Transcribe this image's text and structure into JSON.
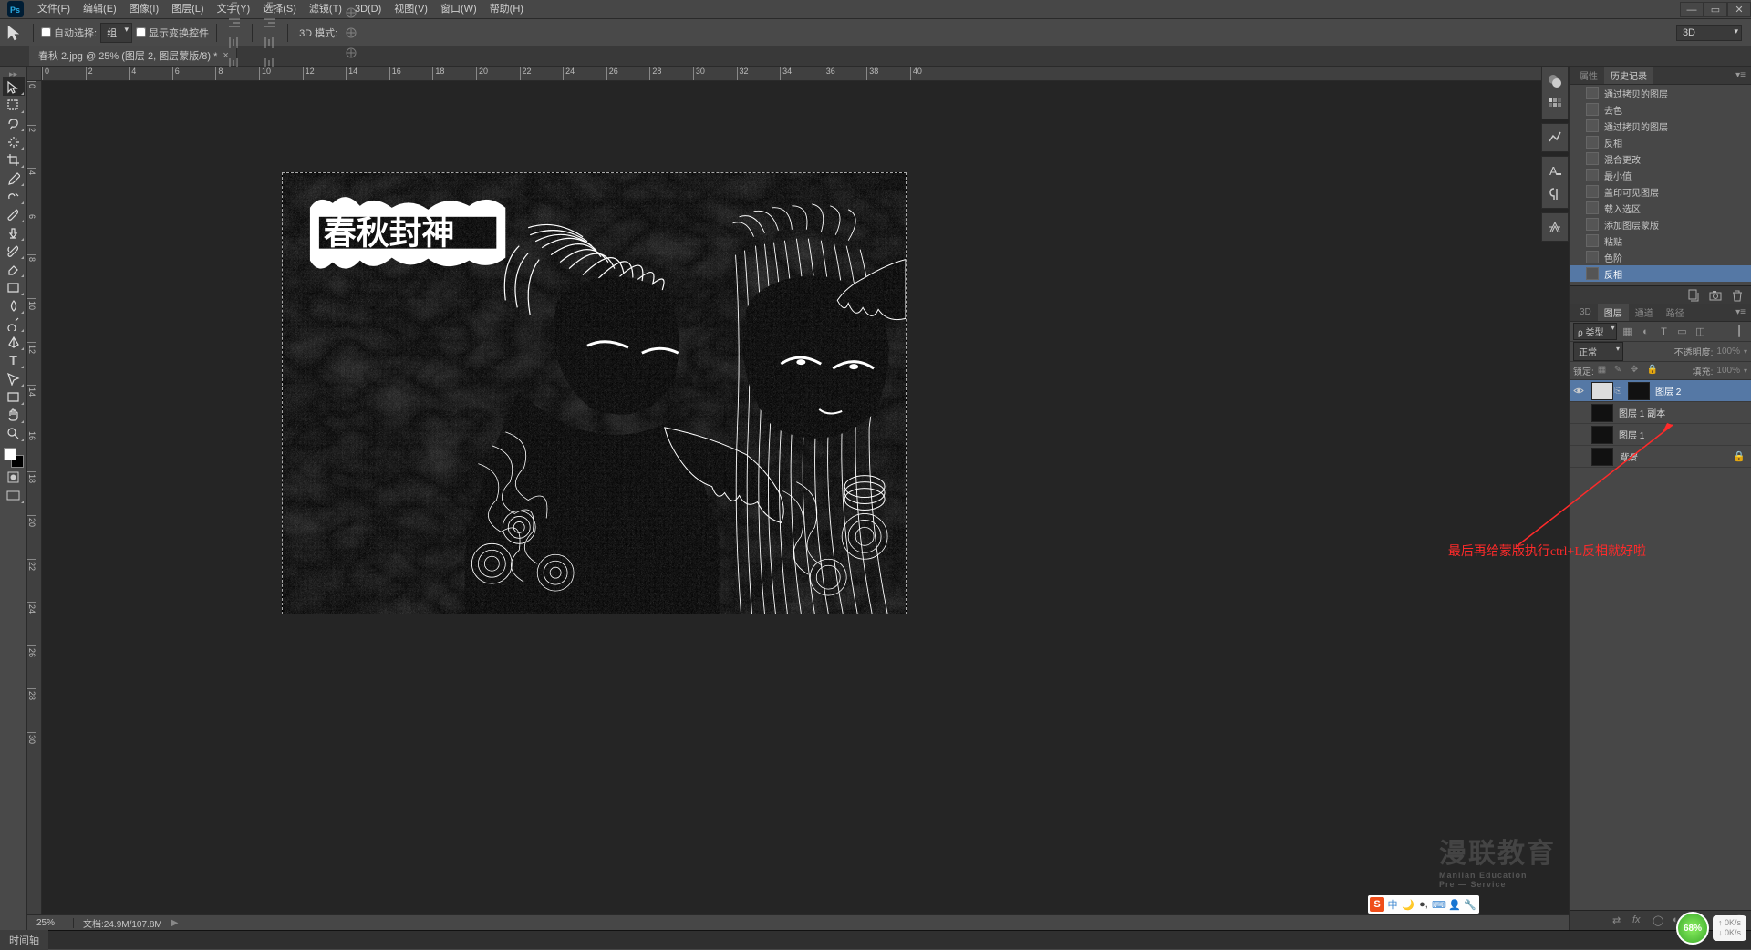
{
  "menu": [
    "文件(F)",
    "编辑(E)",
    "图像(I)",
    "图层(L)",
    "文字(Y)",
    "选择(S)",
    "滤镜(T)",
    "3D(D)",
    "视图(V)",
    "窗口(W)",
    "帮助(H)"
  ],
  "options": {
    "auto_select": "自动选择:",
    "group": "组",
    "show_transform": "显示变换控件",
    "mode_3d": "3D 模式:",
    "right_dd": "3D"
  },
  "doc_tab": {
    "title": "春秋 2.jpg @ 25% (图层 2, 图层蒙版/8) *"
  },
  "ruler_ticks_h": [
    0,
    2,
    4,
    6,
    8,
    10,
    12,
    14,
    16,
    18,
    20,
    22,
    24,
    26,
    28,
    30,
    32,
    34,
    36,
    38,
    40
  ],
  "ruler_ticks_v": [
    0,
    2,
    4,
    6,
    8,
    10,
    12,
    14,
    16,
    18,
    20,
    22,
    24,
    26,
    28,
    30
  ],
  "panels": {
    "props": "属性",
    "history": "历史记录",
    "history_items": [
      {
        "label": "通过拷贝的图层",
        "active": false
      },
      {
        "label": "去色",
        "active": false
      },
      {
        "label": "通过拷贝的图层",
        "active": false
      },
      {
        "label": "反相",
        "active": false
      },
      {
        "label": "混合更改",
        "active": false
      },
      {
        "label": "最小值",
        "active": false
      },
      {
        "label": "盖印可见图层",
        "active": false
      },
      {
        "label": "载入选区",
        "active": false
      },
      {
        "label": "添加图层蒙版",
        "active": false
      },
      {
        "label": "粘贴",
        "active": false
      },
      {
        "label": "色阶",
        "active": false
      },
      {
        "label": "反相",
        "active": true
      }
    ],
    "layers_tabs": [
      "3D",
      "图层",
      "通道",
      "路径"
    ],
    "layers_active_tab": "图层",
    "kind_label": "ρ 类型",
    "normal": "正常",
    "opacity_label": "不透明度:",
    "opacity_val": "100%",
    "lock_label": "锁定:",
    "fill_label": "填充:",
    "fill_val": "100%",
    "layers": [
      {
        "name": "图层 2",
        "mask": true,
        "active": true,
        "visible": true
      },
      {
        "name": "图层 1 副本",
        "mask": false,
        "active": false,
        "visible": false
      },
      {
        "name": "图层 1",
        "mask": false,
        "active": false,
        "visible": false
      },
      {
        "name": "背景",
        "mask": false,
        "active": false,
        "visible": false,
        "bg": true,
        "locked": true
      }
    ]
  },
  "status": {
    "zoom": "25%",
    "info": "文档:24.9M/107.8M"
  },
  "bottom_tab": "时间轴",
  "annotation": "最后再给蒙版执行ctrl+L反相就好啦",
  "watermark": "漫联教育",
  "watermark_sub": "Manlian Education",
  "watermark_sub2": "Pre — Service",
  "speed": {
    "pct": "68%",
    "up": "0K/s",
    "down": "0K/s"
  }
}
